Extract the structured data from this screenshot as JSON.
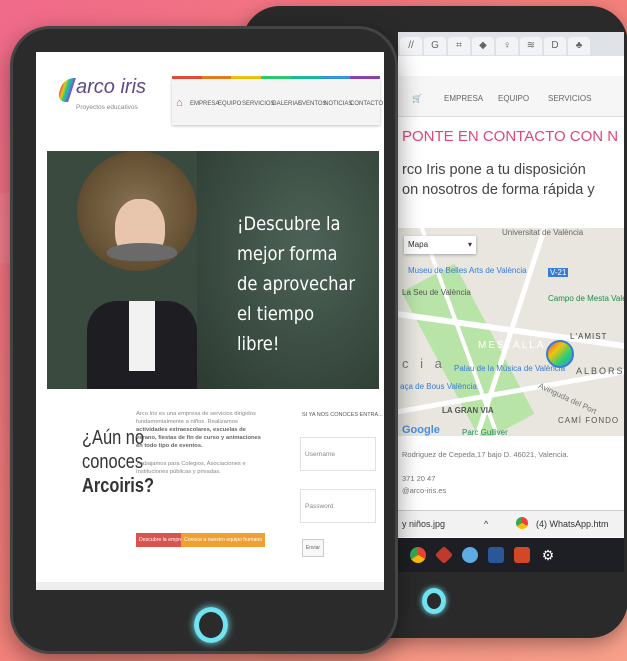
{
  "back_browser": {
    "tabs": [
      "//",
      "G",
      "⌗",
      "◆",
      "♀",
      "≋",
      "D",
      "♣"
    ],
    "nav": [
      "EMPRESA",
      "EQUIPO",
      "SERVICIOS"
    ],
    "heading": "PONTE EN CONTACTO CON N",
    "intro_line1": "rco Iris pone a tu disposición",
    "intro_line2": "on nosotros de forma rápida y",
    "map": {
      "type_select": "Mapa",
      "labels": {
        "univ": "Universitat de València",
        "museo": "Museu de Belles Arts de València",
        "seu": "La Seu de València",
        "campo": "Campo de Mesta Valencia CF",
        "mestalla": "MESTALLA",
        "amistat": "L'AMIST",
        "albors": "ALBORS",
        "cia": "c i a",
        "palau": "Palau de la Música de València",
        "placa": "aça de Bous València",
        "granvia": "LA GRAN VIA",
        "cami": "CAMÍ FONDO",
        "gulliver": "Parc Gulliver",
        "google": "Google",
        "v21": "V-21",
        "port": "Avinguda del Port"
      }
    },
    "address_line1": "Rodriguez de Cepeda,17 bajo D. 46021, Valencia.",
    "address_line2": "371 20 47",
    "address_line3": "@arco-iris.es",
    "download_file": "y niños.jpg",
    "download_other": "(4) WhatsApp.htm"
  },
  "front_site": {
    "logo_text": "arco iris",
    "logo_sub": "Proyectos educativos",
    "nav": [
      "EMPRESA",
      "EQUIPO",
      "SERVICIOS",
      "GALERIAS",
      "EVENTOS",
      "NOTICIAS",
      "CONTACTO"
    ],
    "hero_text": "¡Descubre la mejor forma de aprovechar el tiempo libre!",
    "question_line1": "¿Aún no",
    "question_line2": "conoces",
    "question_line3": "Arcoiris?",
    "para1": "Arco Iris es una empresa de servicios dirigidos fundamentalmente a niños. Realizamos",
    "para1_bold": "actividades extraescolares, escuelas de verano, fiestas de fin de curso y animaciones en todo tipo de eventos.",
    "para2": "Trabajamos para Colegios, Asociaciones e Instituciones públicas y privadas.",
    "btn_company": "Descubre la empresa",
    "btn_team": "Conoce a nuestro equipo humano",
    "login_title": "SI YA NOS CONOCES ENTRA...",
    "username_placeholder": "Username",
    "password_placeholder": "Password",
    "submit_label": "Enviar"
  },
  "colors": {
    "background": "#f47f7a",
    "bezel": "#2b2b2b",
    "home_ring": "#6fe3ef",
    "heading_pink": "#e0457b",
    "btn_red": "#d9534f",
    "btn_orange": "#f0a030"
  }
}
